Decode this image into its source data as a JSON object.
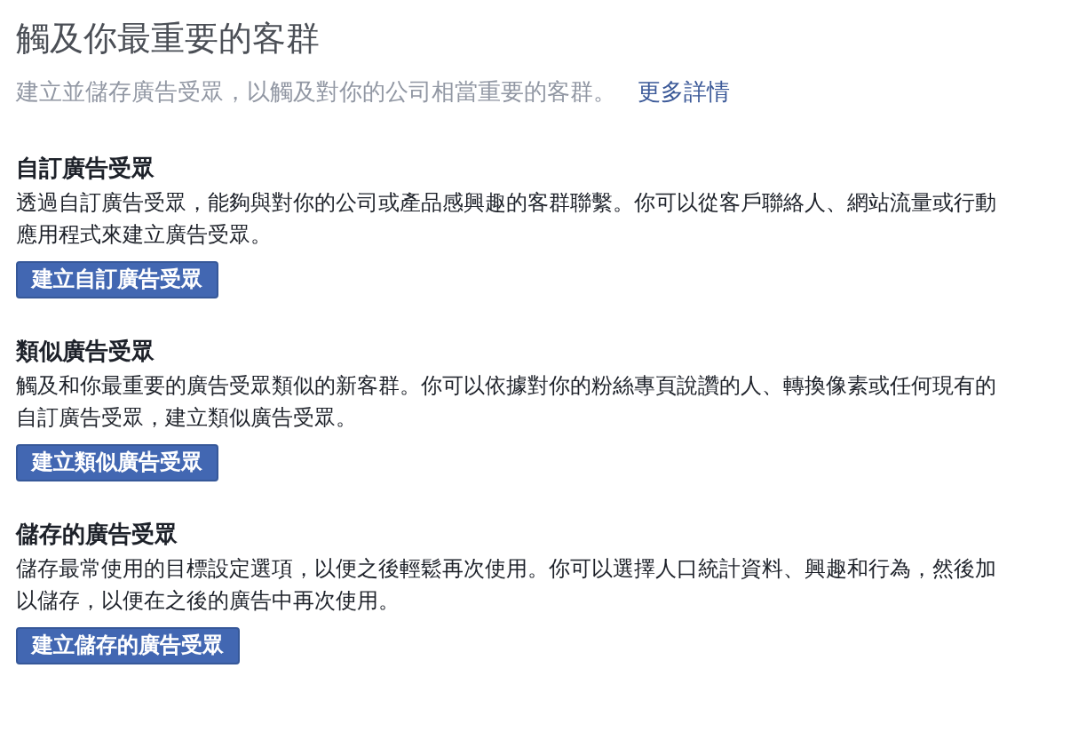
{
  "header": {
    "title": "觸及你最重要的客群",
    "subtitle": "建立並儲存廣告受眾，以觸及對你的公司相當重要的客群。",
    "link": "更多詳情"
  },
  "sections": [
    {
      "heading": "自訂廣告受眾",
      "description": "透過自訂廣告受眾，能夠與對你的公司或產品感興趣的客群聯繫。你可以從客戶聯絡人、網站流量或行動應用程式來建立廣告受眾。",
      "button": "建立自訂廣告受眾"
    },
    {
      "heading": "類似廣告受眾",
      "description": "觸及和你最重要的廣告受眾類似的新客群。你可以依據對你的粉絲專頁說讚的人、轉換像素或任何現有的自訂廣告受眾，建立類似廣告受眾。",
      "button": "建立類似廣告受眾"
    },
    {
      "heading": "儲存的廣告受眾",
      "description": "儲存最常使用的目標設定選項，以便之後輕鬆再次使用。你可以選擇人口統計資料、興趣和行為，然後加以儲存，以便在之後的廣告中再次使用。",
      "button": "建立儲存的廣告受眾"
    }
  ]
}
